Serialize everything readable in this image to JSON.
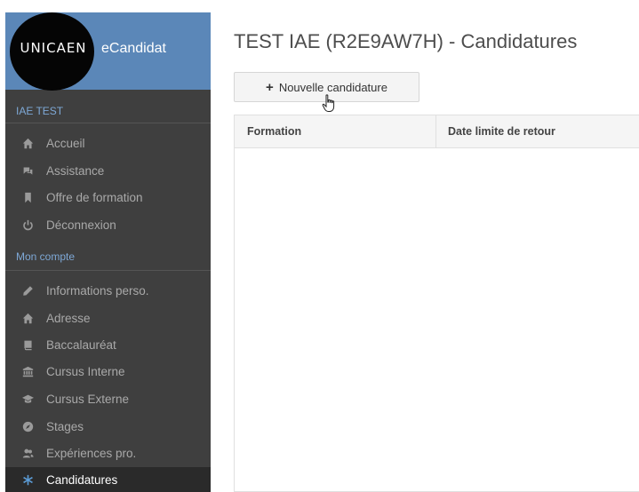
{
  "sidebar": {
    "logo_text": "UNICAEN",
    "app_title": "eCandidat",
    "section_1": "IAE TEST",
    "section_2": "Mon compte",
    "nav_1": [
      {
        "label": "Accueil",
        "icon": "home-icon"
      },
      {
        "label": "Assistance",
        "icon": "support-icon"
      },
      {
        "label": "Offre de formation",
        "icon": "bookmark-icon"
      },
      {
        "label": "Déconnexion",
        "icon": "power-icon"
      }
    ],
    "nav_2": [
      {
        "label": "Informations perso.",
        "icon": "pencil-icon"
      },
      {
        "label": "Adresse",
        "icon": "home-icon"
      },
      {
        "label": "Baccalauréat",
        "icon": "book-icon"
      },
      {
        "label": "Cursus Interne",
        "icon": "institution-icon"
      },
      {
        "label": "Cursus Externe",
        "icon": "graduation-cap-icon"
      },
      {
        "label": "Stages",
        "icon": "compass-icon"
      },
      {
        "label": "Expériences pro.",
        "icon": "users-icon"
      },
      {
        "label": "Candidatures",
        "icon": "asterisk-icon",
        "active": true
      }
    ]
  },
  "main": {
    "title": "TEST IAE (R2E9AW7H) - Candidatures",
    "new_button_label": "Nouvelle candidature",
    "table": {
      "columns": [
        "Formation",
        "Date limite de retour"
      ],
      "rows": []
    }
  },
  "colors": {
    "sidebar_bg": "#3f3f3f",
    "header_blue": "#5b87b8",
    "section_label": "#7ea8d6",
    "active_icon": "#5b9bd5"
  }
}
